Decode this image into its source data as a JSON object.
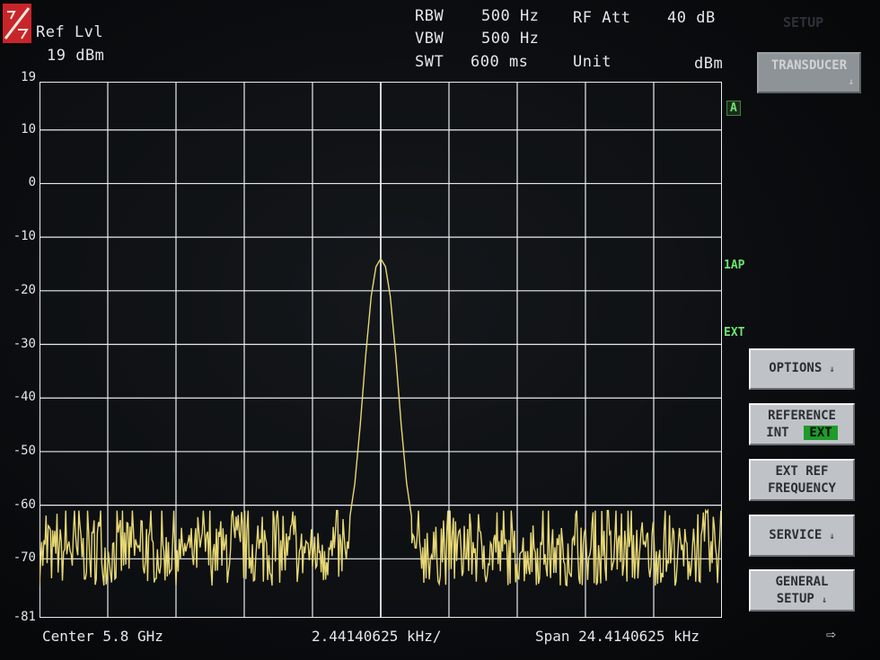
{
  "header": {
    "ref_lvl_label": "Ref Lvl",
    "ref_lvl_value": "19 dBm",
    "rbw_label": "RBW",
    "rbw_value": "500 Hz",
    "vbw_label": "VBW",
    "vbw_value": "500 Hz",
    "swt_label": "SWT",
    "swt_value": "600 ms",
    "rf_att_label": "RF Att",
    "rf_att_value": "40 dB",
    "unit_label": "Unit",
    "unit_value": "dBm",
    "setup_label": "SETUP"
  },
  "side_labels": {
    "trace": "A",
    "detector": "1AP",
    "ext": "EXT"
  },
  "softkeys": {
    "transducer": "TRANSDUCER",
    "options": "OPTIONS",
    "reference_line1": "REFERENCE",
    "reference_int": "INT",
    "reference_ext": "EXT",
    "ext_ref_line1": "EXT REF",
    "ext_ref_line2": "FREQUENCY",
    "service": "SERVICE",
    "general_line1": "GENERAL",
    "general_line2": "SETUP",
    "menu_arrow": "⇓"
  },
  "footer": {
    "center": "Center 5.8 GHz",
    "per_div": "2.44140625 kHz/",
    "span": "Span 24.4140625 kHz",
    "next_arrow": "⇨"
  },
  "chart_data": {
    "type": "line",
    "xlabel": "",
    "ylabel": "",
    "x_center": "5.8 GHz",
    "x_span_khz": 24.4140625,
    "x_per_div_khz": 2.44140625,
    "xlim_div": [
      0,
      10
    ],
    "ylim": [
      -81,
      19
    ],
    "y_ticks": [
      19,
      10,
      0,
      -10,
      -20,
      -30,
      -40,
      -50,
      -60,
      -70,
      -81
    ],
    "grid": true,
    "series": [
      {
        "color": "#e6d774",
        "peak": {
          "x_div": 5.0,
          "level": -14
        },
        "noise_floor_range": [
          -81,
          -61
        ],
        "shape_points": [
          [
            4.55,
            -62
          ],
          [
            4.62,
            -56
          ],
          [
            4.7,
            -45
          ],
          [
            4.78,
            -32
          ],
          [
            4.86,
            -21
          ],
          [
            4.93,
            -15.5
          ],
          [
            5.0,
            -14
          ],
          [
            5.07,
            -15.5
          ],
          [
            5.14,
            -21
          ],
          [
            5.22,
            -32
          ],
          [
            5.3,
            -45
          ],
          [
            5.38,
            -56
          ],
          [
            5.45,
            -62
          ]
        ]
      }
    ]
  },
  "colors": {
    "trace": "#e6d774",
    "grid": "#e9ecef",
    "side_label": "#6fe26f",
    "softkey_bg": "#bfc3c7",
    "ext_active": "#1e9b2a"
  }
}
